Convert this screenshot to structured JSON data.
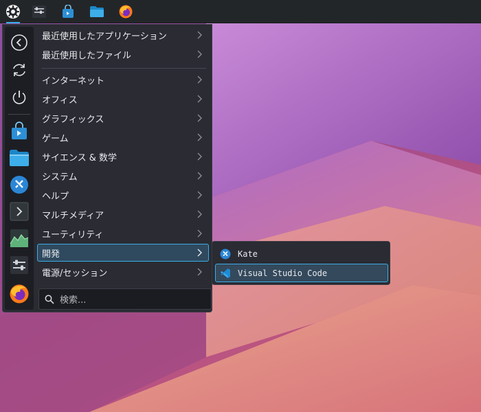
{
  "panel": {
    "items": [
      {
        "name": "application-launcher",
        "icon": "kde-launcher-icon"
      },
      {
        "name": "system-settings",
        "icon": "settings-sliders-icon"
      },
      {
        "name": "discover",
        "icon": "store-bag-icon"
      },
      {
        "name": "dolphin",
        "icon": "folder-icon"
      },
      {
        "name": "firefox",
        "icon": "firefox-icon"
      }
    ]
  },
  "sidebar": {
    "items": [
      {
        "name": "back",
        "icon": "back-arrow-icon"
      },
      {
        "name": "restart",
        "icon": "restart-icon"
      },
      {
        "name": "shutdown",
        "icon": "power-icon"
      },
      {
        "name": "discover",
        "icon": "store-bag-icon"
      },
      {
        "name": "dolphin",
        "icon": "folder-icon"
      },
      {
        "name": "kdeconnect",
        "icon": "kde-app-icon"
      },
      {
        "name": "konsole",
        "icon": "terminal-icon"
      },
      {
        "name": "system-monitor",
        "icon": "system-monitor-icon"
      },
      {
        "name": "system-settings",
        "icon": "settings-sliders-icon"
      },
      {
        "name": "firefox",
        "icon": "firefox-icon"
      }
    ]
  },
  "menu": {
    "items": [
      {
        "label": "最近使用したアプリケーション"
      },
      {
        "label": "最近使用したファイル"
      },
      {
        "label": "インターネット"
      },
      {
        "label": "オフィス"
      },
      {
        "label": "グラフィックス"
      },
      {
        "label": "ゲーム"
      },
      {
        "label": "サイエンス & 数学"
      },
      {
        "label": "システム"
      },
      {
        "label": "ヘルプ"
      },
      {
        "label": "マルチメディア"
      },
      {
        "label": "ユーティリティ"
      },
      {
        "label": "開発",
        "selected": true
      },
      {
        "label": "電源/セッション"
      }
    ]
  },
  "search": {
    "placeholder": "検索..."
  },
  "submenu": {
    "items": [
      {
        "label": "Kate",
        "icon": "kate-icon"
      },
      {
        "label": "Visual Studio Code",
        "icon": "vscode-icon",
        "selected": true
      }
    ]
  },
  "colors": {
    "accent": "#3daee9",
    "panel": "#232629",
    "menu_bg": "#2a2b33"
  }
}
